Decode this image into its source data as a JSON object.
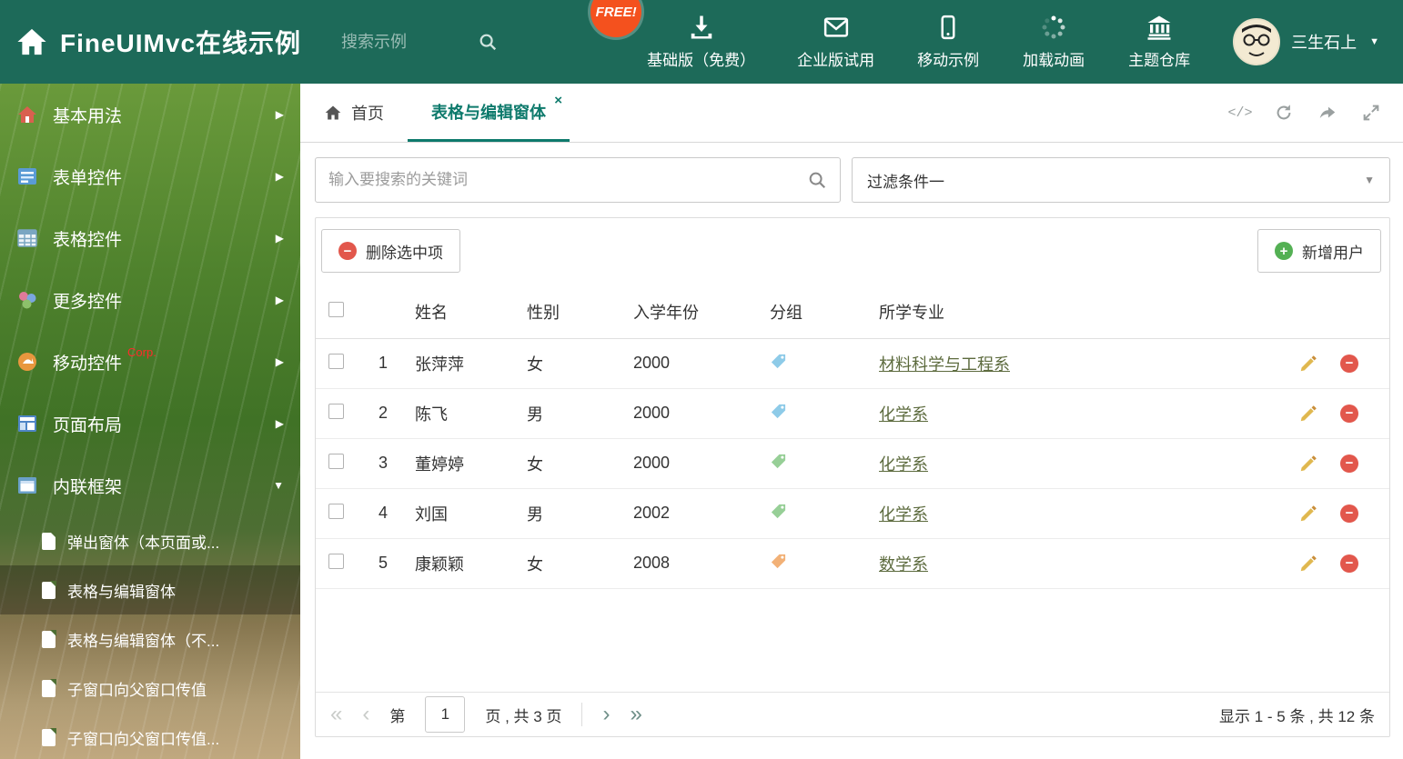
{
  "colors": {
    "header_bg": "#1d6a59",
    "accent": "#0e7a6c",
    "free_badge": "#f4511e",
    "delete_red": "#e2574c",
    "add_green": "#54b054",
    "link": "#5d6b3e"
  },
  "header": {
    "title": "FineUIMvc在线示例",
    "search_placeholder": "搜索示例",
    "free_badge": "FREE!",
    "nav_items": [
      {
        "label": "基础版（免费）",
        "icon": "download-icon"
      },
      {
        "label": "企业版试用",
        "icon": "envelope-icon"
      },
      {
        "label": "移动示例",
        "icon": "mobile-icon"
      },
      {
        "label": "加载动画",
        "icon": "spinner-icon"
      },
      {
        "label": "主题仓库",
        "icon": "bank-icon"
      }
    ],
    "username": "三生石上"
  },
  "sidebar": {
    "items": [
      {
        "label": "基本用法"
      },
      {
        "label": "表单控件"
      },
      {
        "label": "表格控件"
      },
      {
        "label": "更多控件"
      },
      {
        "label": "移动控件",
        "badge": "Corp."
      },
      {
        "label": "页面布局"
      },
      {
        "label": "内联框架"
      }
    ],
    "subitems": [
      {
        "label": "弹出窗体（本页面或..."
      },
      {
        "label": "表格与编辑窗体"
      },
      {
        "label": "表格与编辑窗体（不..."
      },
      {
        "label": "子窗口向父窗口传值"
      },
      {
        "label": "子窗口向父窗口传值..."
      }
    ]
  },
  "tabs": {
    "home": "首页",
    "active": "表格与编辑窗体"
  },
  "filters": {
    "search_placeholder": "输入要搜索的关键词",
    "filter_selected": "过滤条件一"
  },
  "toolbar": {
    "delete_selected": "删除选中项",
    "add_user": "新增用户"
  },
  "table": {
    "headers": {
      "name": "姓名",
      "gender": "性别",
      "year": "入学年份",
      "group": "分组",
      "major": "所学专业"
    },
    "rows": [
      {
        "index": "1",
        "name": "张萍萍",
        "gender": "女",
        "year": "2000",
        "tag_color": "#8ecbe8",
        "major": "材料科学与工程系"
      },
      {
        "index": "2",
        "name": "陈飞",
        "gender": "男",
        "year": "2000",
        "tag_color": "#8ecbe8",
        "major": "化学系"
      },
      {
        "index": "3",
        "name": "董婷婷",
        "gender": "女",
        "year": "2000",
        "tag_color": "#97cf97",
        "major": "化学系"
      },
      {
        "index": "4",
        "name": "刘国",
        "gender": "男",
        "year": "2002",
        "tag_color": "#97cf97",
        "major": "化学系"
      },
      {
        "index": "5",
        "name": "康颖颖",
        "gender": "女",
        "year": "2008",
        "tag_color": "#f2b177",
        "major": "数学系"
      }
    ]
  },
  "pagination": {
    "page_prefix": "第",
    "current_page": "1",
    "page_suffix": "页 , 共 3 页",
    "summary": "显示 1 - 5 条 , 共 12 条"
  }
}
